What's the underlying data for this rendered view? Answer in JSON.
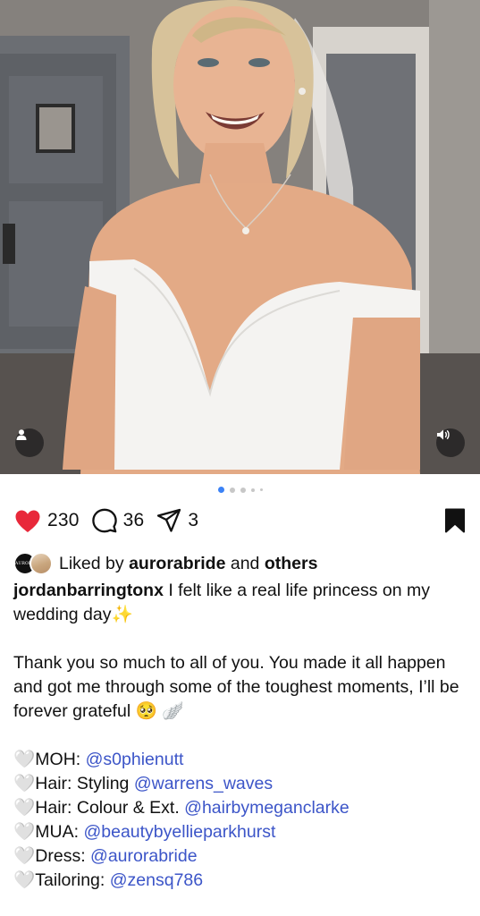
{
  "post": {
    "likes_count": "230",
    "comments_count": "36",
    "shares_count": "3",
    "carousel": {
      "total_dots": 5,
      "active_index": 0
    },
    "liked_by": {
      "prefix": "Liked by",
      "user": "aurorabride",
      "connector": "and",
      "others": "others",
      "avatar1_text": "AURORA"
    },
    "caption": {
      "username": "jordanbarringtonx",
      "line1": "I felt like a real life princess on my wedding day✨",
      "paragraph2": "Thank you so much to all of you. You made it all happen and got me through some of the toughest moments, I’ll be forever grateful 🥺 🪽",
      "credits": [
        {
          "heart": "🤍",
          "label": "MOH: ",
          "handle": "@s0phienutt"
        },
        {
          "heart": "🤍",
          "label": "Hair: Styling ",
          "handle": "@warrens_waves"
        },
        {
          "heart": "🤍",
          "label": "Hair: Colour & Ext. ",
          "handle": "@hairbymeganclarke"
        },
        {
          "heart": "🤍",
          "label": "MUA: ",
          "handle": "@beautybyellieparkhurst"
        },
        {
          "heart": "🤍",
          "label": "Dress: ",
          "handle": "@aurorabride"
        },
        {
          "heart": "🤍",
          "label": "Tailoring: ",
          "handle": "@zensq786"
        }
      ]
    }
  },
  "icons": {
    "like": "heart-filled-red",
    "comment": "speech-bubble",
    "share": "paper-plane",
    "save": "bookmark-filled",
    "tag": "person",
    "audio": "speaker"
  },
  "colors": {
    "like_red": "#e8283a",
    "link_blue": "#3c55c8",
    "active_dot": "#3b82f6"
  }
}
